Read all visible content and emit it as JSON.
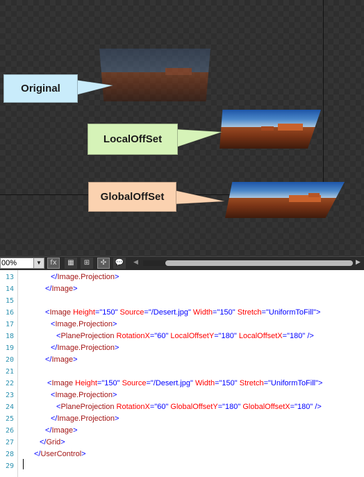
{
  "canvas": {
    "callouts": {
      "original": {
        "label": "Original",
        "color": "#c9ecfb"
      },
      "local": {
        "label": "LocalOffSet",
        "color": "#d6f3b8"
      },
      "global": {
        "label": "GlobalOffSet",
        "color": "#fbd2b0"
      }
    }
  },
  "toolbar": {
    "zoom_value": "00%",
    "buttons": [
      {
        "name": "formula-button",
        "glyph": "fx",
        "active": true
      },
      {
        "name": "grid-button",
        "glyph": "▦",
        "active": false
      },
      {
        "name": "snap-grid-button",
        "glyph": "⊞",
        "active": false
      },
      {
        "name": "snap-lines-button",
        "glyph": "✣",
        "active": true
      },
      {
        "name": "annotation-button",
        "glyph": "💬",
        "active": false
      }
    ]
  },
  "editor": {
    "lines": [
      {
        "n": "13",
        "indent": 5,
        "tokens": [
          [
            "b",
            "</"
          ],
          [
            "t",
            "Image.Projection"
          ],
          [
            "b",
            ">"
          ]
        ]
      },
      {
        "n": "14",
        "indent": 4,
        "tokens": [
          [
            "b",
            "</"
          ],
          [
            "t",
            "Image"
          ],
          [
            "b",
            ">"
          ]
        ]
      },
      {
        "n": "15",
        "indent": 0,
        "tokens": []
      },
      {
        "n": "16",
        "indent": 4,
        "tokens": [
          [
            "b",
            "<"
          ],
          [
            "t",
            "Image"
          ],
          [
            "a",
            " Height"
          ],
          [
            "b",
            "="
          ],
          [
            "v",
            "\"150\""
          ],
          [
            "a",
            " Source"
          ],
          [
            "b",
            "="
          ],
          [
            "v",
            "\"/Desert.jpg\""
          ],
          [
            "a",
            " Width"
          ],
          [
            "b",
            "="
          ],
          [
            "v",
            "\"150\""
          ],
          [
            "a",
            " Stretch"
          ],
          [
            "b",
            "="
          ],
          [
            "v",
            "\"UniformToFill\""
          ],
          [
            "b",
            ">"
          ]
        ]
      },
      {
        "n": "17",
        "indent": 5,
        "tokens": [
          [
            "b",
            "<"
          ],
          [
            "t",
            "Image.Projection"
          ],
          [
            "b",
            ">"
          ]
        ]
      },
      {
        "n": "18",
        "indent": 6,
        "tokens": [
          [
            "b",
            "<"
          ],
          [
            "t",
            "PlaneProjection"
          ],
          [
            "a",
            " RotationX"
          ],
          [
            "b",
            "="
          ],
          [
            "v",
            "\"60\""
          ],
          [
            "a",
            " LocalOffsetY"
          ],
          [
            "b",
            "="
          ],
          [
            "v",
            "\"180\""
          ],
          [
            "a",
            " LocalOffsetX"
          ],
          [
            "b",
            "="
          ],
          [
            "v",
            "\"180\""
          ],
          [
            "b",
            " />"
          ]
        ]
      },
      {
        "n": "19",
        "indent": 5,
        "tokens": [
          [
            "b",
            "</"
          ],
          [
            "t",
            "Image.Projection"
          ],
          [
            "b",
            ">"
          ]
        ]
      },
      {
        "n": "20",
        "indent": 4,
        "tokens": [
          [
            "b",
            "</"
          ],
          [
            "t",
            "Image"
          ],
          [
            "b",
            ">"
          ]
        ]
      },
      {
        "n": "21",
        "indent": 0,
        "tokens": []
      },
      {
        "n": "22",
        "indent": 4,
        "tokens": [
          [
            "b",
            " <"
          ],
          [
            "t",
            "Image"
          ],
          [
            "a",
            " Height"
          ],
          [
            "b",
            "="
          ],
          [
            "v",
            "\"150\""
          ],
          [
            "a",
            " Source"
          ],
          [
            "b",
            "="
          ],
          [
            "v",
            "\"/Desert.jpg\""
          ],
          [
            "a",
            " Width"
          ],
          [
            "b",
            "="
          ],
          [
            "v",
            "\"150\""
          ],
          [
            "a",
            " Stretch"
          ],
          [
            "b",
            "="
          ],
          [
            "v",
            "\"UniformToFill\""
          ],
          [
            "b",
            ">"
          ]
        ]
      },
      {
        "n": "23",
        "indent": 5,
        "tokens": [
          [
            "b",
            "<"
          ],
          [
            "t",
            "Image.Projection"
          ],
          [
            "b",
            ">"
          ]
        ]
      },
      {
        "n": "24",
        "indent": 6,
        "tokens": [
          [
            "b",
            "<"
          ],
          [
            "t",
            "PlaneProjection"
          ],
          [
            "a",
            " RotationX"
          ],
          [
            "b",
            "="
          ],
          [
            "v",
            "\"60\""
          ],
          [
            "a",
            " GlobalOffsetY"
          ],
          [
            "b",
            "="
          ],
          [
            "v",
            "\"180\""
          ],
          [
            "a",
            " GlobalOffsetX"
          ],
          [
            "b",
            "="
          ],
          [
            "v",
            "\"180\""
          ],
          [
            "b",
            " />"
          ]
        ]
      },
      {
        "n": "25",
        "indent": 5,
        "tokens": [
          [
            "b",
            "</"
          ],
          [
            "t",
            "Image.Projection"
          ],
          [
            "b",
            ">"
          ]
        ]
      },
      {
        "n": "26",
        "indent": 4,
        "tokens": [
          [
            "b",
            "</"
          ],
          [
            "t",
            "Image"
          ],
          [
            "b",
            ">"
          ]
        ]
      },
      {
        "n": "27",
        "indent": 3,
        "tokens": [
          [
            "b",
            "</"
          ],
          [
            "t",
            "Grid"
          ],
          [
            "b",
            ">"
          ]
        ]
      },
      {
        "n": "28",
        "indent": 2,
        "tokens": [
          [
            "b",
            "</"
          ],
          [
            "t",
            "UserControl"
          ],
          [
            "b",
            ">"
          ]
        ]
      },
      {
        "n": "29",
        "indent": 0,
        "tokens": []
      }
    ]
  }
}
